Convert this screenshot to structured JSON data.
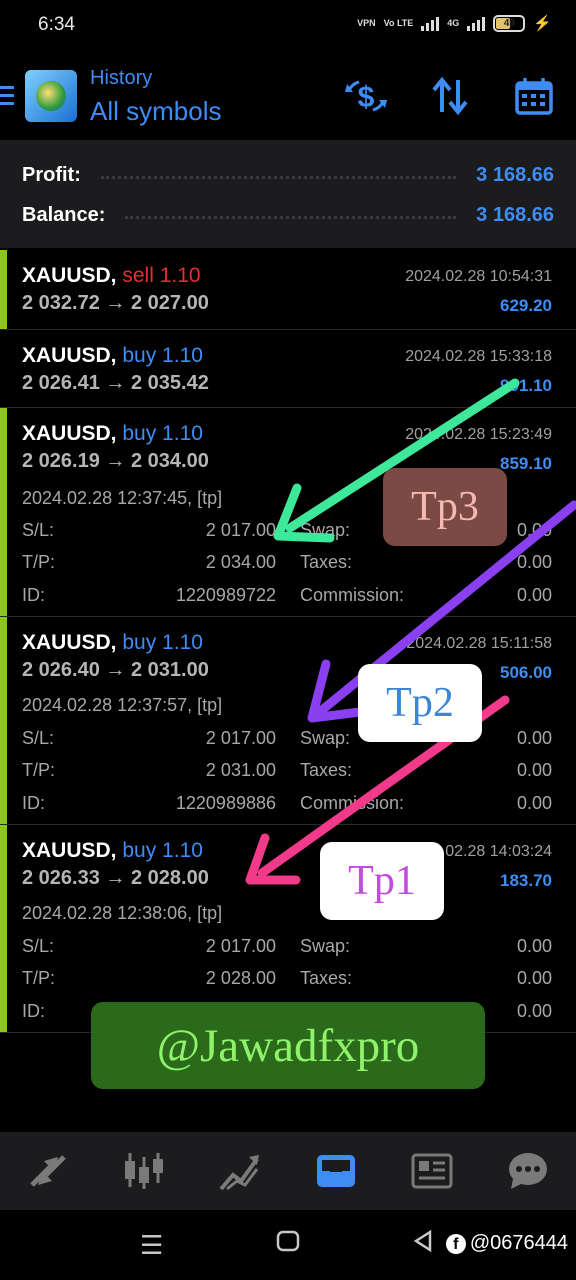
{
  "status_bar": {
    "time": "6:34",
    "vpn": "VPN",
    "volte": "Vo LTE",
    "network": "4G",
    "battery": "49"
  },
  "header": {
    "subtitle": "History",
    "title": "All symbols"
  },
  "summary": {
    "profit_label": "Profit:",
    "profit_value": "3 168.66",
    "balance_label": "Balance:",
    "balance_value": "3 168.66"
  },
  "trades": [
    {
      "symbol": "XAUUSD,",
      "side": "sell 1.10",
      "prices": "2 032.72 → 2 027.00",
      "date": "2024.02.28 10:54:31",
      "profit": "629.20"
    },
    {
      "symbol": "XAUUSD,",
      "side": "buy 1.10",
      "prices": "2 026.41 → 2 035.42",
      "date": "2024.02.28 15:33:18",
      "profit": "991.10"
    },
    {
      "symbol": "XAUUSD,",
      "side": "buy 1.10",
      "prices": "2 026.19 → 2 034.00",
      "date": "2024.02.28 15:23:49",
      "profit": "859.10",
      "close_time": "2024.02.28 12:37:45, [tp]",
      "sl_label": "S/L:",
      "sl": "2 017.00",
      "tp_label": "T/P:",
      "tp": "2 034.00",
      "id_label": "ID:",
      "id": "1220989722",
      "swap_label": "Swap:",
      "swap": "0.00",
      "taxes_label": "Taxes:",
      "taxes": "0.00",
      "commission_label": "Commission:",
      "commission": "0.00"
    },
    {
      "symbol": "XAUUSD,",
      "side": "buy 1.10",
      "prices": "2 026.40 → 2 031.00",
      "date": "2024.02.28 15:11:58",
      "profit": "506.00",
      "close_time": "2024.02.28 12:37:57, [tp]",
      "sl_label": "S/L:",
      "sl": "2 017.00",
      "tp_label": "T/P:",
      "tp": "2 031.00",
      "id_label": "ID:",
      "id": "1220989886",
      "swap_label": "Swap:",
      "swap": "0.00",
      "taxes_label": "Taxes:",
      "taxes": "0.00",
      "commission_label": "Commission:",
      "commission": "0.00"
    },
    {
      "symbol": "XAUUSD,",
      "side": "buy 1.10",
      "prices": "2 026.33 → 2 028.00",
      "date": "2024.02.28 14:03:24",
      "profit": "183.70",
      "close_time": "2024.02.28 12:38:06, [tp]",
      "sl_label": "S/L:",
      "sl": "2 017.00",
      "tp_label": "T/P:",
      "tp": "2 028.00",
      "id_label": "ID:",
      "swap_label": "Swap:",
      "swap": "0.00",
      "taxes_label": "Taxes:",
      "taxes": "0.00",
      "commission": "0.00"
    }
  ],
  "annotations": {
    "tp3": "Tp3",
    "tp2": "Tp2",
    "tp1": "Tp1",
    "watermark": "@Jawadfxpro",
    "colors": {
      "tp3_arrow": "#3ee89a",
      "tp2_arrow": "#8a3ff0",
      "tp1_arrow": "#f23a8a",
      "tp3_box": "#7b4a44",
      "tp3_text": "#f6b8b2",
      "tp2_text": "#3d86d6",
      "tp1_text": "#c24be0"
    }
  },
  "bottom_nav": [
    "trade-icon",
    "quotes-icon",
    "chart-icon",
    "history-icon",
    "news-icon",
    "chat-icon"
  ],
  "system_nav": {
    "fb_handle": "@0676444"
  },
  "colors": {
    "accent": "#3d8df5",
    "sell": "#e0302f",
    "trade_bar": "#8bc61a"
  }
}
